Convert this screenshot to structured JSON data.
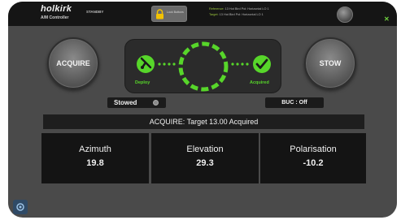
{
  "header": {
    "brand": "holkirk",
    "subtitle": "A/M Controller",
    "mode": "STANDBY",
    "lock_button_label": "Lock Buttons",
    "reference_label": "Reference:",
    "reference_value": "13 Hot Bird Pol: Horizontal LO 1",
    "target_label": "Target:",
    "target_value": "13 Hot Bird Pol: Horizontal LO 1",
    "close_icon": "close-icon"
  },
  "controls": {
    "acquire_label": "ACQUIRE",
    "stow_label": "STOW"
  },
  "status_panel": {
    "deploy_label": "Deploy",
    "acquired_label": "Acquired",
    "accent_color": "#57d62a"
  },
  "indicators": {
    "stowed_label": "Stowed",
    "buc_label": "BUC : Off"
  },
  "message": "ACQUIRE: Target 13.00 Acquired",
  "readings": {
    "azimuth_label": "Azimuth",
    "azimuth_value": "19.8",
    "elevation_label": "Elevation",
    "elevation_value": "29.3",
    "polarisation_label": "Polarisation",
    "polarisation_value": "-10.2"
  }
}
